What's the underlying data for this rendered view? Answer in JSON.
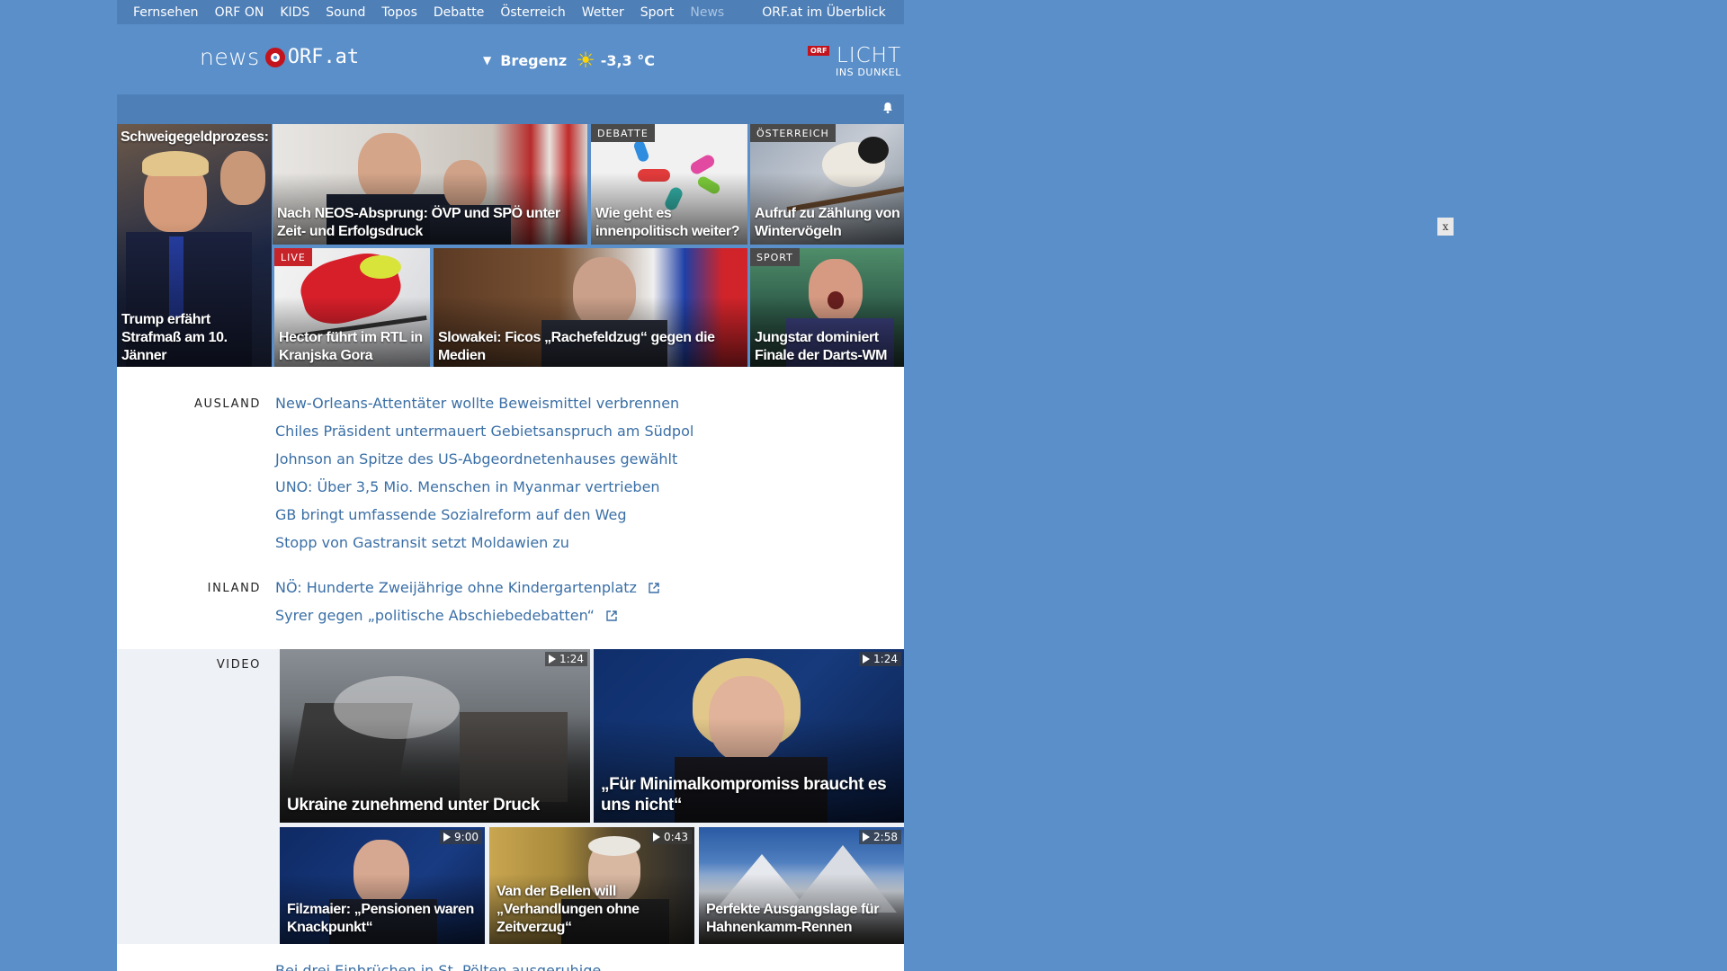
{
  "top_nav": {
    "items": [
      "Fernsehen",
      "ORF ON",
      "KIDS",
      "Sound",
      "Topos",
      "Debatte",
      "Österreich",
      "Wetter",
      "Sport",
      "News"
    ],
    "active": "News",
    "overview": "ORF.at im Überblick"
  },
  "header": {
    "logo_news": "news",
    "logo_orf": "ORF.at",
    "weather_city": "Bregenz",
    "weather_temp": "-3,3 °C",
    "lid_badge": "ORF",
    "lid_title": "LICHT",
    "lid_subtitle": "INS DUNKEL"
  },
  "teasers": {
    "trump": {
      "top": "Schweigegeldprozess:",
      "title": "Trump erfährt Strafmaß am 10. Jänner"
    },
    "neos": {
      "title": "Nach NEOS-Absprung: ÖVP und SPÖ unter Zeit- und Erfolgsdruck"
    },
    "debatte": {
      "label": "DEBATTE",
      "title": "Wie geht es innenpolitisch weiter?"
    },
    "voegel": {
      "label": "ÖSTERREICH",
      "title": "Aufruf zu Zählung von Wintervögeln"
    },
    "hector": {
      "label": "LIVE",
      "title": "Hector führt im RTL in Kranjska Gora"
    },
    "fico": {
      "title": "Slowakei: Ficos „Rachefeldzug“ gegen die Medien"
    },
    "darts": {
      "label": "SPORT",
      "title": "Jungstar dominiert Finale der Darts-WM"
    }
  },
  "ausland": {
    "label": "AUSLAND",
    "links": [
      "New-Orleans-Attentäter wollte Beweismittel verbrennen",
      "Chiles Präsident untermauert Gebietsanspruch am Südpol",
      "Johnson an Spitze des US-Abgeordnetenhauses gewählt",
      "UNO: Über 3,5 Mio. Menschen in Myanmar vertrieben",
      "GB bringt umfassende Sozialreform auf den Weg",
      "Stopp von Gastransit setzt Moldawien zu"
    ]
  },
  "inland": {
    "label": "INLAND",
    "links": [
      "NÖ: Hunderte Zweijährige ohne Kindergartenplatz",
      "Syrer gegen „politische Abschiebedebatten“"
    ]
  },
  "video": {
    "label": "VIDEO",
    "items": [
      {
        "title": "Ukraine zunehmend unter Druck",
        "duration": "1:24"
      },
      {
        "title": "„Für Minimalkompromiss braucht es uns nicht“",
        "duration": "1:24"
      },
      {
        "title": "Filzmaier: „Pensionen waren Knackpunkt“",
        "duration": "9:00"
      },
      {
        "title": "Van der Bellen will „Verhandlungen ohne Zeitverzug“",
        "duration": "0:43"
      },
      {
        "title": "Perfekte Ausgangslage für Hahnenkamm-Rennen",
        "duration": "2:58"
      }
    ]
  },
  "bottom": {
    "partial_link": "Bei drei Einbrüchen in St. Pölten ausgeruhige"
  },
  "overlay": {
    "close": "x"
  }
}
